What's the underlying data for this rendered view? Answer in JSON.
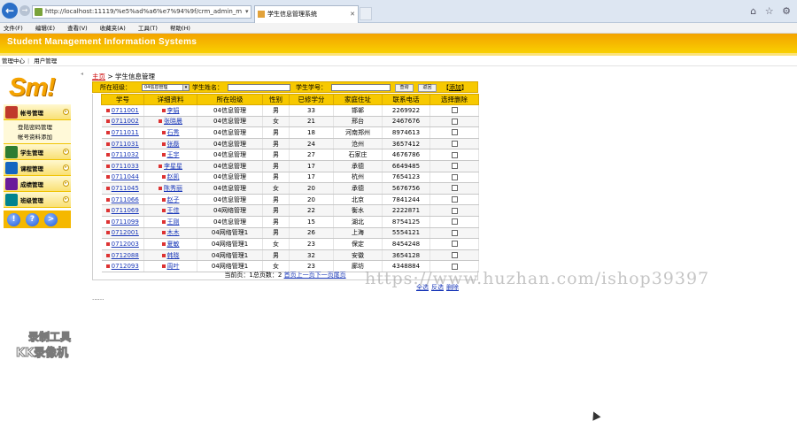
{
  "browser": {
    "url": "http://localhost:11119/%e5%ad%a6%e7%94%9f/crm_admin_m",
    "addr_buttons": "▾ ↻ ✕",
    "tab_title": "学生信息管理系统",
    "corner_icons": "⌂ ☆ ⚙"
  },
  "menubar": [
    "文件(F)",
    "编辑(E)",
    "查看(V)",
    "收藏夹(A)",
    "工具(T)",
    "帮助(H)"
  ],
  "banner": {
    "title": "Student Management Information Systems"
  },
  "subnav": {
    "item1": "管理中心",
    "sep": "|",
    "item2": "用户管理"
  },
  "sidebar": {
    "logo": "Sm!",
    "items": [
      {
        "label": "帐号管理",
        "icon": "account-icon",
        "color": "#c0392b"
      },
      {
        "label": "学生管理",
        "icon": "student-icon",
        "color": "#2e7d32"
      },
      {
        "label": "课程管理",
        "icon": "course-icon",
        "color": "#1565c0"
      },
      {
        "label": "成绩管理",
        "icon": "score-icon",
        "color": "#6a1b9a"
      },
      {
        "label": "班级管理",
        "icon": "class-icon",
        "color": "#00838f"
      }
    ],
    "sub_items": [
      "登陆密码管理",
      "帐号资料添加"
    ],
    "bottom_buttons": [
      "!",
      "?",
      ">"
    ]
  },
  "crumb": {
    "home": "主页",
    "rest": " > 学生信息管理"
  },
  "search": {
    "class_label": "所在班级：",
    "class_value": "04信息管理",
    "name_label": "学生姓名：",
    "id_label": "学生学号：",
    "query_button": "查询",
    "back_button": "返回",
    "add_link": "添加"
  },
  "table": {
    "headers": [
      "学号",
      "详细资料",
      "所在班级",
      "性别",
      "已修学分",
      "家庭住址",
      "联系电话",
      "选择删除"
    ],
    "rows": [
      [
        "0711001",
        "李娟",
        "04信息管理",
        "男",
        "33",
        "邯郸",
        "2269922"
      ],
      [
        "0711002",
        "张晓晨",
        "04信息管理",
        "女",
        "21",
        "邢台",
        "2467676"
      ],
      [
        "0711011",
        "石秀",
        "04信息管理",
        "男",
        "18",
        "河南郑州",
        "8974613"
      ],
      [
        "0711031",
        "张磊",
        "04信息管理",
        "男",
        "24",
        "沧州",
        "3657412"
      ],
      [
        "0711032",
        "王宇",
        "04信息管理",
        "男",
        "27",
        "石家庄",
        "4676786"
      ],
      [
        "0711033",
        "李星星",
        "04信息管理",
        "男",
        "17",
        "承德",
        "6649485"
      ],
      [
        "0711044",
        "赵凯",
        "04信息管理",
        "男",
        "17",
        "杭州",
        "7654123"
      ],
      [
        "0711045",
        "陈秀丽",
        "04信息管理",
        "女",
        "20",
        "承德",
        "5676756"
      ],
      [
        "0711066",
        "赵子",
        "04信息管理",
        "男",
        "20",
        "北京",
        "7841244"
      ],
      [
        "0711069",
        "王佳",
        "04网络管理",
        "男",
        "22",
        "衡水",
        "2222871"
      ],
      [
        "0711099",
        "王刚",
        "04信息管理",
        "男",
        "15",
        "湖北",
        "8754125"
      ],
      [
        "0712001",
        "木木",
        "04网络管理1",
        "男",
        "26",
        "上海",
        "5554121"
      ],
      [
        "0712003",
        "夏敏",
        "04网络管理1",
        "女",
        "23",
        "保定",
        "8454248"
      ],
      [
        "0712088",
        "韩晓",
        "04网络管理1",
        "男",
        "32",
        "安徽",
        "3654128"
      ],
      [
        "0712093",
        "周叶",
        "04网络管理1",
        "女",
        "23",
        "廊坊",
        "4348884"
      ]
    ]
  },
  "pager": {
    "text": "当前页：1总页数：2",
    "first": "首页",
    "prev": "上一页",
    "next": "下一页",
    "last": "尾页"
  },
  "footlinks": [
    "全选",
    "反选",
    "删除"
  ],
  "dots": "......",
  "watermark": "https://www.huzhan.com/ishop39397",
  "recorder": {
    "line1": "录制工具",
    "line2": "KK录像机"
  }
}
